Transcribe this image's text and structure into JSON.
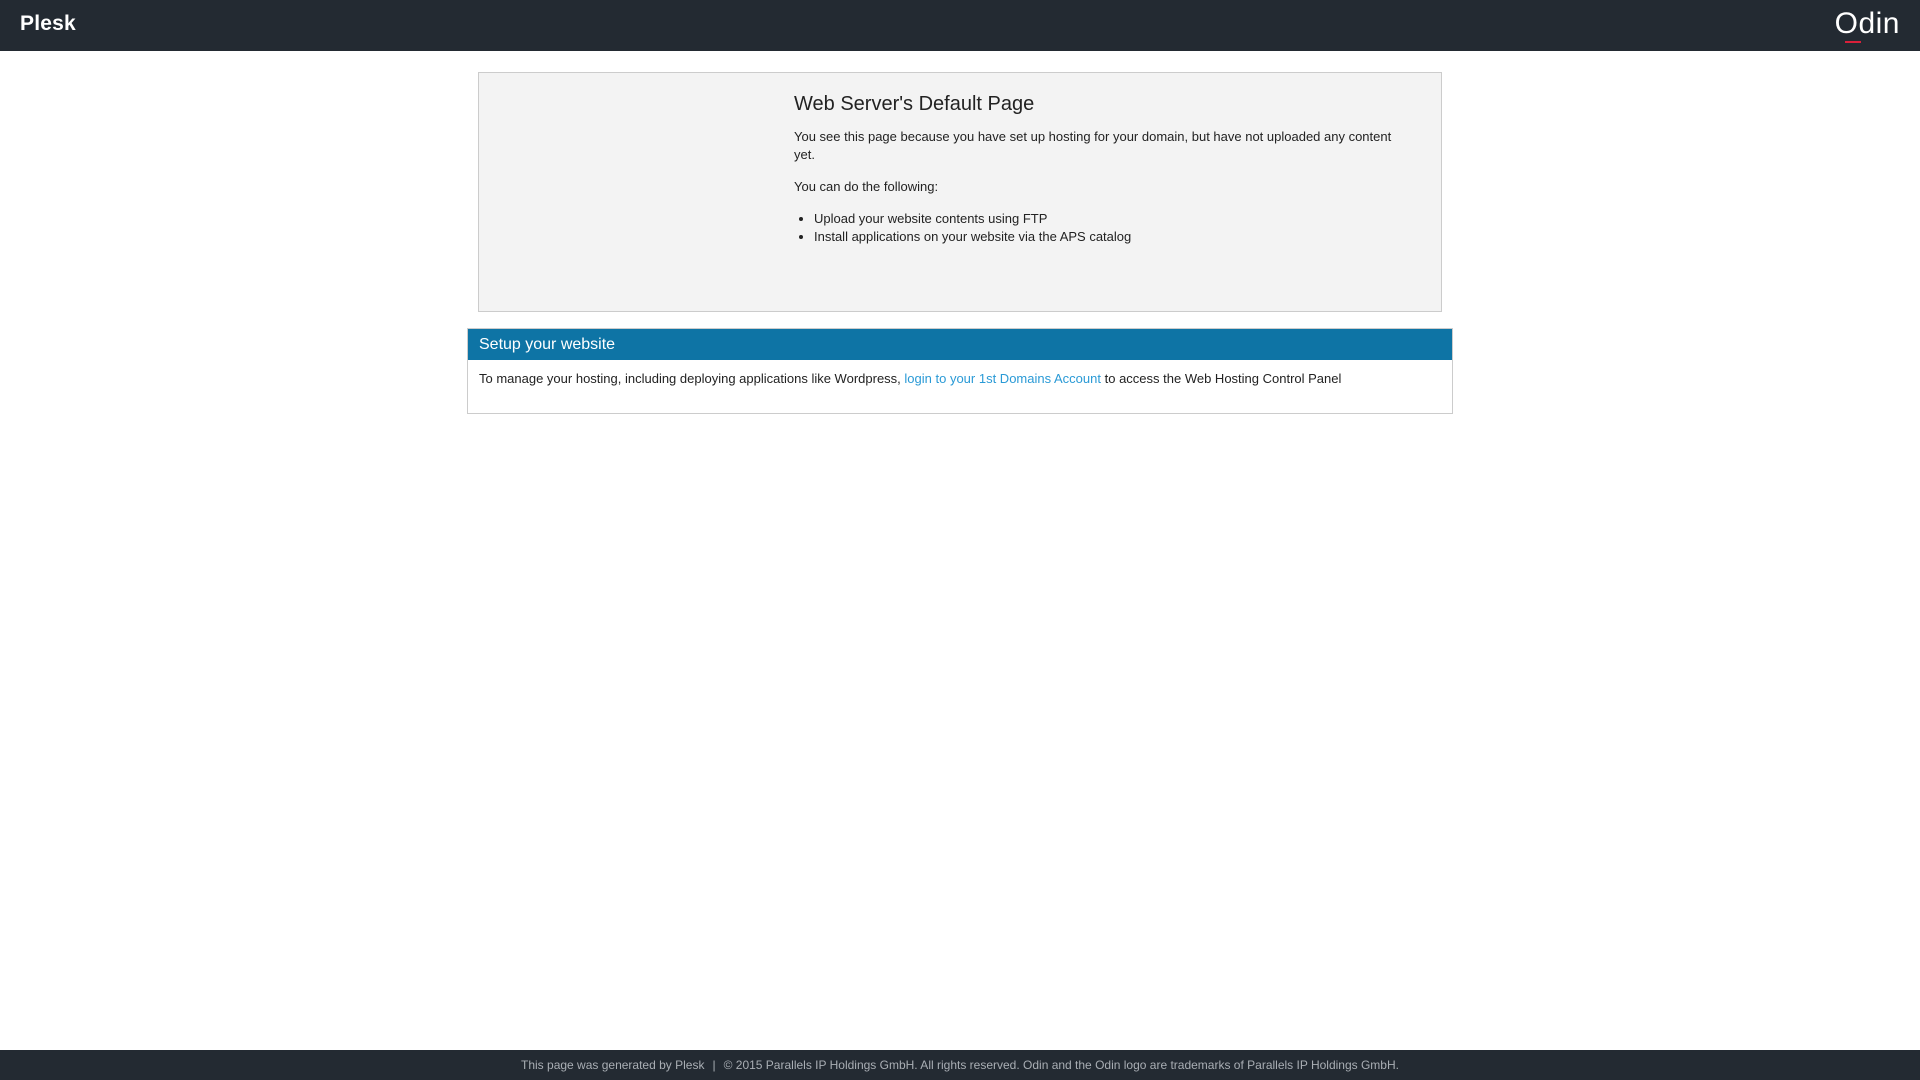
{
  "header": {
    "brand": "Plesk",
    "logo_text": "Odin"
  },
  "default_page": {
    "title": "Web Server's Default Page",
    "intro": "You see this page because you have set up hosting for your domain, but have not uploaded any content yet.",
    "can_do": "You can do the following:",
    "actions": [
      "Upload your website contents using FTP",
      "Install applications on your website via the APS catalog"
    ]
  },
  "setup": {
    "title": "Setup your website",
    "text_before": "To manage your hosting, including deploying applications like Wordpress,",
    "link_label": "login to your 1st Domains Account",
    "text_after": "to access the Web Hosting Control Panel"
  },
  "footer": {
    "generated": "This page was generated by Plesk",
    "separator": "|",
    "copyright": "© 2015 Parallels IP Holdings GmbH. All rights reserved. Odin and the Odin logo are trademarks of Parallels IP Holdings GmbH."
  },
  "colors": {
    "topbar": "#232a32",
    "setup_header": "#0e74a5",
    "link": "#2a9ad6",
    "odin_accent": "#d9203a"
  }
}
